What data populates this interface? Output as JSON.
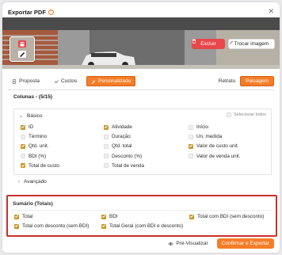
{
  "header": {
    "title": "Exportar PDF",
    "info_icon": "info-icon",
    "close_icon": "close-icon",
    "info_glyph": "!",
    "close_glyph": "✕"
  },
  "banner": {
    "delete_label": "Excluir",
    "replace_label": "Trocar imagem",
    "accent": "#e8474c"
  },
  "tabs": {
    "proposta": "Proposta",
    "custos": "Custos",
    "personalizado": "Personalizado"
  },
  "orientation": {
    "retrato": "Retrato",
    "paisagem": "Paisagem",
    "selected": "Paisagem"
  },
  "columns": {
    "title": "Colunas - (5/15)",
    "basic_label": "Básico",
    "select_all": "Selecionar todos",
    "advanced_label": "Avançado",
    "items": [
      {
        "label": "ID",
        "checked": true
      },
      {
        "label": "Atividade",
        "checked": true
      },
      {
        "label": "Início",
        "checked": false
      },
      {
        "label": "Término",
        "checked": false
      },
      {
        "label": "Duração",
        "checked": false
      },
      {
        "label": "Un. medida",
        "checked": false
      },
      {
        "label": "Qtd. unit.",
        "checked": true
      },
      {
        "label": "Qtd. total",
        "checked": false
      },
      {
        "label": "Valor de custo unit.",
        "checked": true
      },
      {
        "label": "BDI (%)",
        "checked": false
      },
      {
        "label": "Desconto (%)",
        "checked": false
      },
      {
        "label": "Valor de venda unit.",
        "checked": false
      },
      {
        "label": "Total de custo",
        "checked": true
      },
      {
        "label": "Total de venda",
        "checked": false
      }
    ]
  },
  "summary": {
    "title": "Sumário (Totais)",
    "items": [
      {
        "label": "Total",
        "checked": true
      },
      {
        "label": "BDI",
        "checked": true
      },
      {
        "label": "Total com BDI (sem desconto)",
        "checked": true
      },
      {
        "label": "Total com desconto (sem BDI)",
        "checked": true
      },
      {
        "label": "Total Geral (com BDI e desconto)",
        "checked": true
      }
    ]
  },
  "footer": {
    "preview_label": "Pré-Visualizar",
    "confirm_label": "Confirmar e Exportar"
  },
  "colors": {
    "accent": "#f57d28",
    "checkbox": "#c9952a",
    "highlight": "#c8302d"
  }
}
